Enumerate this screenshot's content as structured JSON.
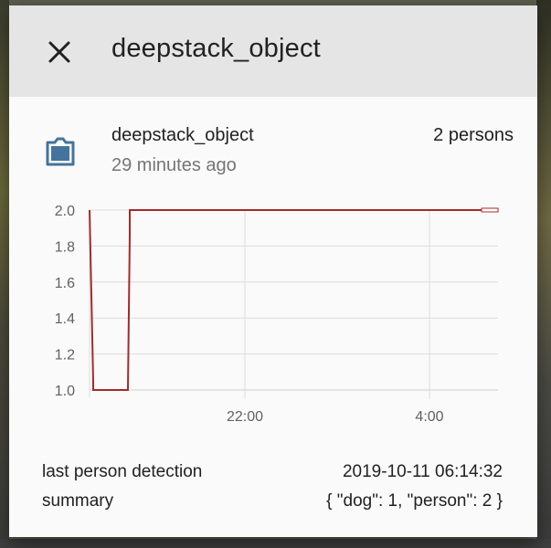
{
  "dialog": {
    "title": "deepstack_object",
    "close_icon": "close-icon"
  },
  "entity": {
    "icon": "camera-frame-icon",
    "name": "deepstack_object",
    "state": "2 persons",
    "last_changed": "29 minutes ago"
  },
  "chart_data": {
    "type": "line",
    "ylim": [
      1.0,
      2.0
    ],
    "yticks": [
      "2.0",
      "1.8",
      "1.6",
      "1.4",
      "1.2",
      "1.0"
    ],
    "xticks": [
      "22:00",
      "4:00"
    ],
    "grid": true,
    "series": [
      {
        "color": "#a52a2a",
        "points": [
          {
            "x": "start",
            "y": 2.0
          },
          {
            "x": "start",
            "y": 1.05
          },
          {
            "x": "start",
            "y": 1.0
          },
          {
            "x": "jump",
            "y": 1.0
          },
          {
            "x": "jump",
            "y": 1.86
          },
          {
            "x": "jump",
            "y": 2.0
          },
          {
            "x": "end",
            "y": 2.0
          }
        ]
      }
    ]
  },
  "attributes": [
    {
      "key": "last person detection",
      "value": "2019-10-11 06:14:32"
    },
    {
      "key": "summary",
      "value": "{ \"dog\": 1, \"person\": 2 }"
    }
  ]
}
